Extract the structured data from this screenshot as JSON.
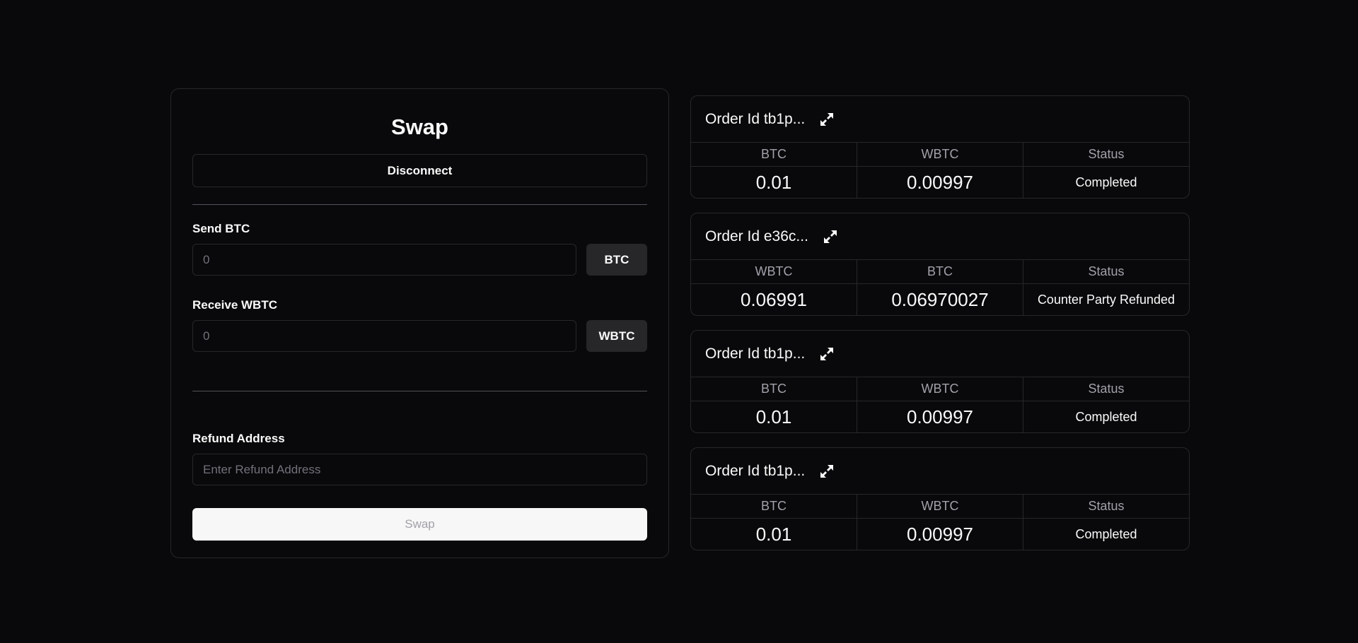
{
  "swap": {
    "title": "Swap",
    "disconnect_label": "Disconnect",
    "send_label": "Send BTC",
    "send_value": "0",
    "send_token": "BTC",
    "receive_label": "Receive WBTC",
    "receive_value": "0",
    "receive_token": "WBTC",
    "refund_label": "Refund Address",
    "refund_placeholder": "Enter Refund Address",
    "swap_button_label": "Swap"
  },
  "orders": [
    {
      "id_label": "Order Id tb1p...",
      "columns": [
        "BTC",
        "WBTC",
        "Status"
      ],
      "values": [
        "0.01",
        "0.00997",
        "Completed"
      ]
    },
    {
      "id_label": "Order Id e36c...",
      "columns": [
        "WBTC",
        "BTC",
        "Status"
      ],
      "values": [
        "0.06991",
        "0.06970027",
        "Counter Party Refunded"
      ]
    },
    {
      "id_label": "Order Id tb1p...",
      "columns": [
        "BTC",
        "WBTC",
        "Status"
      ],
      "values": [
        "0.01",
        "0.00997",
        "Completed"
      ]
    },
    {
      "id_label": "Order Id tb1p...",
      "columns": [
        "BTC",
        "WBTC",
        "Status"
      ],
      "values": [
        "0.01",
        "0.00997",
        "Completed"
      ]
    }
  ],
  "icons": {
    "expand": "expand-arrows-icon"
  },
  "colors": {
    "background": "#09090b",
    "border": "#27272a",
    "text": "#fafafa",
    "muted": "#a1a1aa",
    "primary_button": "#f7f7f7"
  }
}
